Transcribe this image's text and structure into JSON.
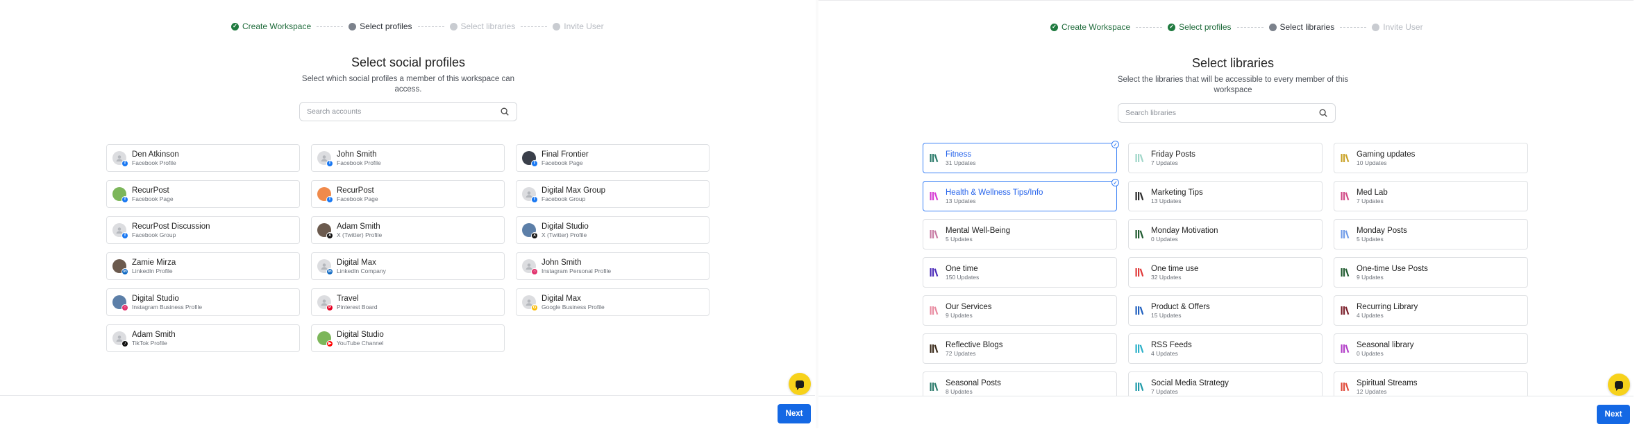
{
  "colors": {
    "accent": "#1468e4",
    "done": "#1f7a3f",
    "selected": "#3b82f6",
    "chat": "#f7d21b"
  },
  "left": {
    "steps": [
      {
        "label": "Create Workspace",
        "state": "done"
      },
      {
        "label": "Select profiles",
        "state": "current"
      },
      {
        "label": "Select libraries",
        "state": "pending"
      },
      {
        "label": "Invite User",
        "state": "pending"
      }
    ],
    "title": "Select social profiles",
    "subtitle": "Select which social profiles a member of this workspace can access.",
    "search_placeholder": "Search accounts",
    "profiles": [
      {
        "name": "Den Atkinson",
        "type": "Facebook Profile",
        "network": "facebook",
        "avatar": "gray"
      },
      {
        "name": "John Smith",
        "type": "Facebook Profile",
        "network": "facebook",
        "avatar": "gray"
      },
      {
        "name": "Final Frontier",
        "type": "Facebook Page",
        "network": "facebook",
        "avatar": "photo-dark"
      },
      {
        "name": "RecurPost",
        "type": "Facebook Page",
        "network": "facebook",
        "avatar": "green"
      },
      {
        "name": "RecurPost",
        "type": "Facebook Page",
        "network": "facebook",
        "avatar": "orange"
      },
      {
        "name": "Digital Max Group",
        "type": "Facebook Group",
        "network": "facebook",
        "avatar": "gray"
      },
      {
        "name": "RecurPost Discussion",
        "type": "Facebook Group",
        "network": "facebook",
        "avatar": "gray"
      },
      {
        "name": "Adam Smith",
        "type": "X (Twitter) Profile",
        "network": "x",
        "avatar": "photo-person"
      },
      {
        "name": "Digital Studio",
        "type": "X (Twitter) Profile",
        "network": "x",
        "avatar": "photo-blue"
      },
      {
        "name": "Zamie Mirza",
        "type": "LinkedIn Profile",
        "network": "linkedin",
        "avatar": "photo-person"
      },
      {
        "name": "Digital Max",
        "type": "LinkedIn Company",
        "network": "linkedin",
        "avatar": "gray"
      },
      {
        "name": "John Smith",
        "type": "Instagram Personal Profile",
        "network": "instagram",
        "avatar": "gray"
      },
      {
        "name": "Digital Studio",
        "type": "Instagram Business Profile",
        "network": "instagram",
        "avatar": "photo-blue"
      },
      {
        "name": "Travel",
        "type": "Pinterest Board",
        "network": "pinterest",
        "avatar": "gray"
      },
      {
        "name": "Digital Max",
        "type": "Google Business Profile",
        "network": "google",
        "avatar": "gray"
      },
      {
        "name": "Adam Smith",
        "type": "TikTok Profile",
        "network": "tiktok",
        "avatar": "gray"
      },
      {
        "name": "Digital Studio",
        "type": "YouTube Channel",
        "network": "youtube",
        "avatar": "green"
      }
    ],
    "next_label": "Next"
  },
  "right": {
    "steps": [
      {
        "label": "Create Workspace",
        "state": "done"
      },
      {
        "label": "Select profiles",
        "state": "done"
      },
      {
        "label": "Select libraries",
        "state": "current"
      },
      {
        "label": "Invite User",
        "state": "pending"
      }
    ],
    "title": "Select libraries",
    "subtitle": "Select the libraries that will be accessible to every member of this workspace",
    "search_placeholder": "Search libraries",
    "libraries": [
      {
        "name": "Fitness",
        "count": "31 Updates",
        "color": "#2a7a6a",
        "selected": true
      },
      {
        "name": "Friday Posts",
        "count": "7 Updates",
        "color": "#9fd6c8",
        "selected": false
      },
      {
        "name": "Gaming updates",
        "count": "10 Updates",
        "color": "#c9a227",
        "selected": false
      },
      {
        "name": "Health & Wellness Tips/Info",
        "count": "13 Updates",
        "color": "#d63bd3",
        "selected": true
      },
      {
        "name": "Marketing Tips",
        "count": "13 Updates",
        "color": "#2a2a2a",
        "selected": false
      },
      {
        "name": "Med Lab",
        "count": "7 Updates",
        "color": "#d04a86",
        "selected": false
      },
      {
        "name": "Mental Well-Being",
        "count": "5 Updates",
        "color": "#c77aa3",
        "selected": false
      },
      {
        "name": "Monday Motivation",
        "count": "0 Updates",
        "color": "#1e5a2e",
        "selected": false
      },
      {
        "name": "Monday Posts",
        "count": "5 Updates",
        "color": "#6f9be8",
        "selected": false
      },
      {
        "name": "One time",
        "count": "150 Updates",
        "color": "#4b2bb8",
        "selected": false
      },
      {
        "name": "One time use",
        "count": "32 Updates",
        "color": "#e03a3a",
        "selected": false
      },
      {
        "name": "One-time Use Posts",
        "count": "9 Updates",
        "color": "#1e5a2e",
        "selected": false
      },
      {
        "name": "Our Services",
        "count": "9 Updates",
        "color": "#e88aa0",
        "selected": false
      },
      {
        "name": "Product & Offers",
        "count": "15 Updates",
        "color": "#1f5fbf",
        "selected": false
      },
      {
        "name": "Recurring Library",
        "count": "4 Updates",
        "color": "#7a1e2a",
        "selected": false
      },
      {
        "name": "Reflective Blogs",
        "count": "72 Updates",
        "color": "#3a2a1a",
        "selected": false
      },
      {
        "name": "RSS Feeds",
        "count": "4 Updates",
        "color": "#2bb0c8",
        "selected": false
      },
      {
        "name": "Seasonal library",
        "count": "0 Updates",
        "color": "#b23fc8",
        "selected": false
      },
      {
        "name": "Seasonal Posts",
        "count": "8 Updates",
        "color": "#2a7a6a",
        "selected": false
      },
      {
        "name": "Social Media Strategy",
        "count": "7 Updates",
        "color": "#1e9aa8",
        "selected": false
      },
      {
        "name": "Spiritual Streams",
        "count": "12 Updates",
        "color": "#e04a3a",
        "selected": false
      }
    ],
    "next_label": "Next"
  }
}
